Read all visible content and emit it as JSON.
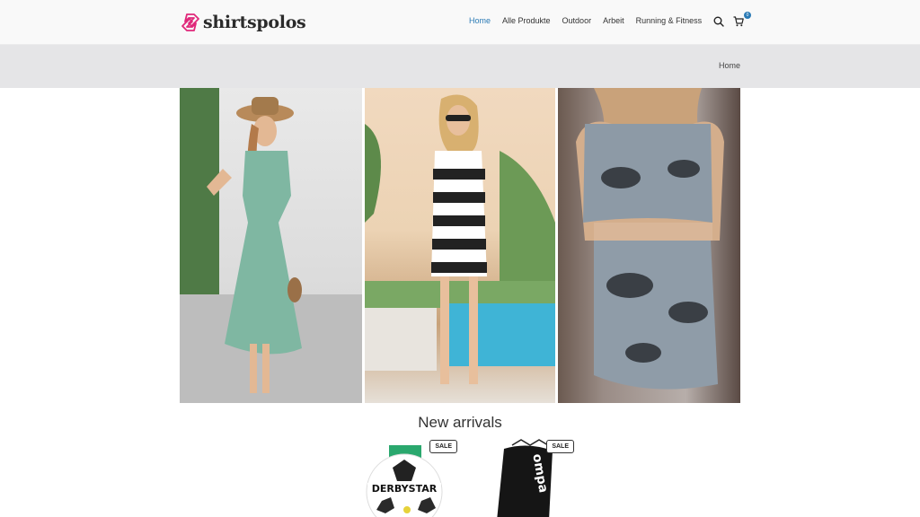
{
  "header": {
    "logo_text": "shirtspolos",
    "nav": [
      "Home",
      "Alle Produkte",
      "Outdoor",
      "Arbeit",
      "Running & Fitness"
    ],
    "active_nav": "Home",
    "cart_count": "0",
    "accent_color": "#2a7ab5",
    "logo_color": "#e0287a"
  },
  "titlebar": {
    "breadcrumb": "Home"
  },
  "hero": {
    "panels": [
      {
        "description_icon": "model-green-dress"
      },
      {
        "description_icon": "model-striped-dress"
      },
      {
        "description_icon": "model-leaf-print-dress"
      }
    ]
  },
  "new_arrivals": {
    "title": "New arrivals",
    "products": [
      {
        "badge": "SALE",
        "image_icon": "football-ball-icon",
        "ball_brand": "DERBYSTAR"
      },
      {
        "badge": "SALE",
        "image_icon": "gym-bag-icon",
        "bag_brand": "ompa"
      }
    ]
  }
}
